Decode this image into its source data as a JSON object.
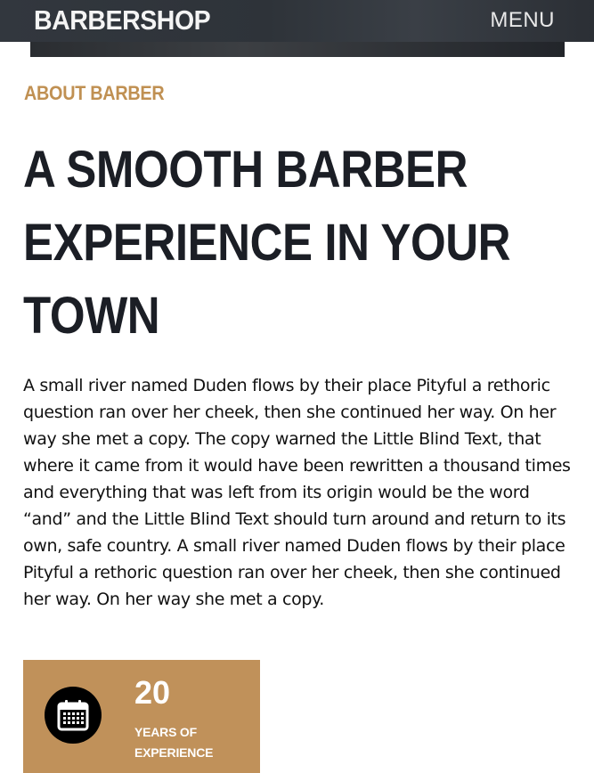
{
  "header": {
    "brand": "BARBERSHOP",
    "menu_label": "MENU"
  },
  "about": {
    "eyebrow": "ABOUT BARBER",
    "headline_lines": [
      "A SMOOTH BARBER",
      "EXPERIENCE IN YOUR",
      "TOWN"
    ],
    "body": "A small river named Duden flows by their place Pityful a rethoric question ran over her cheek, then she continued her way. On her way she met a copy. The copy warned the Little Blind Text, that where it came from it would have been rewritten a thousand times and everything that was left from its origin would be the word “and” and the Little Blind Text should turn around and return to its own, safe country. A small river named Duden flows by their place Pityful a rethoric question ran over her cheek, then she continued her way. On her way she met a copy."
  },
  "stat": {
    "icon": "calendar-icon",
    "number": "20",
    "label": "YEARS OF EXPERIENCE"
  },
  "colors": {
    "accent": "#c0915a",
    "heading": "#1b1e25",
    "topbar": "#32373e"
  }
}
